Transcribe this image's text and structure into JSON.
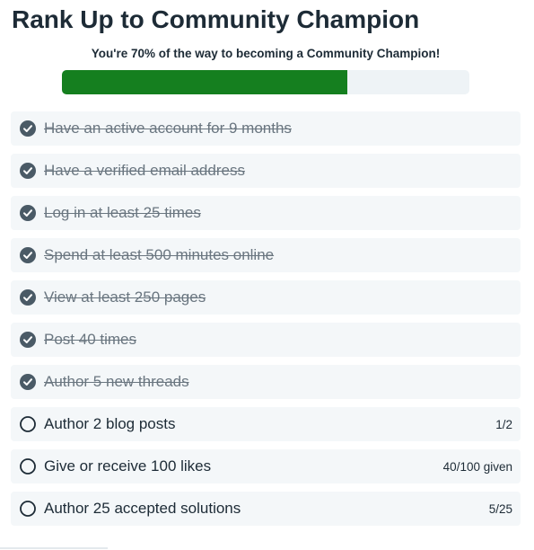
{
  "header": {
    "title": "Rank Up to Community Champion",
    "subtitle": "You're 70% of the way to becoming a Community Champion!"
  },
  "progress": {
    "percent": 70,
    "fill_color": "#157f1f",
    "track_color": "#eef3f6"
  },
  "requirements": [
    {
      "label": "Have an active account for 9 months",
      "completed": true,
      "progress": ""
    },
    {
      "label": "Have a verified email address",
      "completed": true,
      "progress": ""
    },
    {
      "label": "Log in at least 25 times",
      "completed": true,
      "progress": ""
    },
    {
      "label": "Spend at least 500 minutes online",
      "completed": true,
      "progress": ""
    },
    {
      "label": "View at least 250 pages",
      "completed": true,
      "progress": ""
    },
    {
      "label": "Post 40 times",
      "completed": true,
      "progress": ""
    },
    {
      "label": "Author 5 new threads",
      "completed": true,
      "progress": ""
    },
    {
      "label": "Author 2 blog posts",
      "completed": false,
      "progress": "1/2"
    },
    {
      "label": "Give or receive 100 likes",
      "completed": false,
      "progress": "40/100 given"
    },
    {
      "label": "Author 25 accepted solutions",
      "completed": false,
      "progress": "5/25"
    }
  ],
  "icons": {
    "completed": "check-circle-icon",
    "pending": "empty-circle-icon"
  }
}
